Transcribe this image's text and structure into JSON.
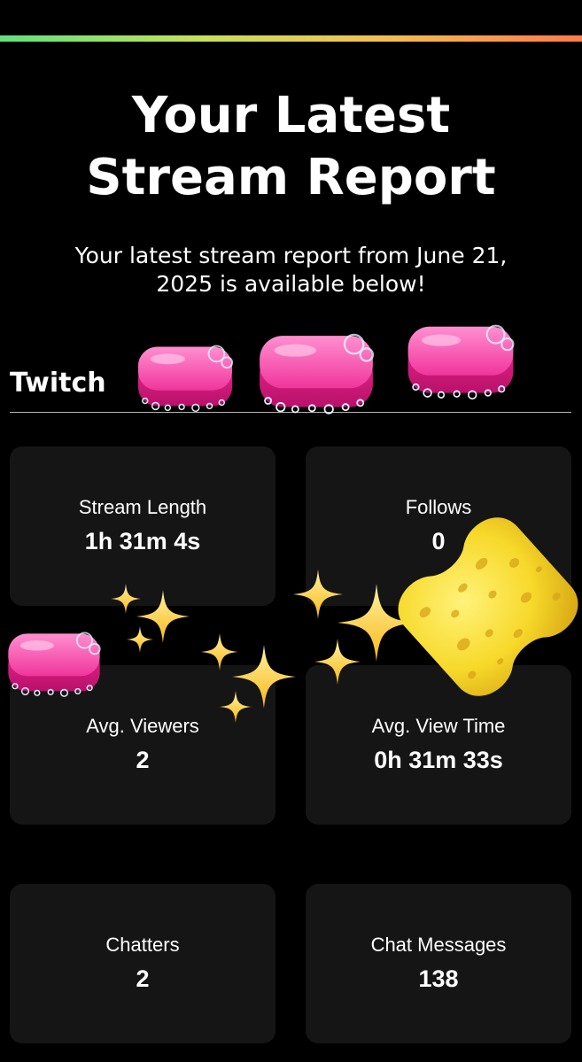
{
  "header": {
    "title_line1": "Your Latest",
    "title_line2": "Stream Report",
    "subtitle_line1": "Your latest stream report from June 21,",
    "subtitle_line2": "2025 is available below!"
  },
  "platform": {
    "name": "Twitch"
  },
  "stats": [
    {
      "label": "Stream Length",
      "value": "1h 31m 4s"
    },
    {
      "label": "Follows",
      "value": "0"
    },
    {
      "label": "Avg. Viewers",
      "value": "2"
    },
    {
      "label": "Avg. View Time",
      "value": "0h 31m 33s"
    },
    {
      "label": "Chatters",
      "value": "2"
    },
    {
      "label": "Chat Messages",
      "value": "138"
    }
  ],
  "stickers": [
    "soap-icon",
    "sparkles-icon",
    "sponge-icon"
  ],
  "colors": {
    "background": "#000000",
    "card": "#151515",
    "text": "#ffffff",
    "gradient": [
      "#5ee37a",
      "#c8e05a",
      "#f2c14e",
      "#ff7a4a"
    ]
  }
}
